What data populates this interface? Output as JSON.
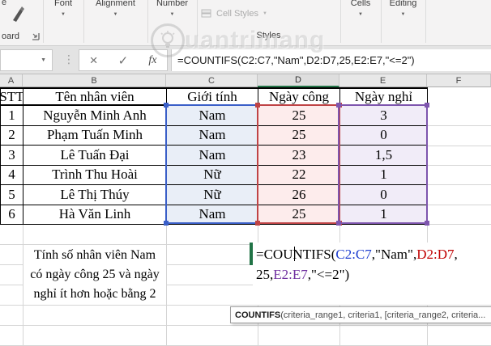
{
  "ribbon": {
    "paste_fragment": "e",
    "clipboard_label": "oard",
    "groups": [
      {
        "label": "Font"
      },
      {
        "label": "Alignment"
      },
      {
        "label": "Number"
      },
      {
        "label": "Cells"
      },
      {
        "label": "Editing"
      }
    ],
    "cell_styles_label": "Cell Styles",
    "styles_group_label": "Styles"
  },
  "watermark": {
    "text": "uantrimang"
  },
  "formula_bar": {
    "value": "=COUNTIFS(C2:C7,\"Nam\",D2:D7,25,E2:E7,\"<=2\")",
    "fx_label": "fx"
  },
  "sheet": {
    "columns": [
      "A",
      "B",
      "C",
      "D",
      "E",
      "F"
    ],
    "active_column": "D"
  },
  "table": {
    "headers": [
      "STT",
      "Tên nhân viên",
      "Giới tính",
      "Ngày công",
      "Ngày nghỉ"
    ],
    "rows": [
      [
        "1",
        "Nguyễn Minh Anh",
        "Nam",
        "25",
        "3"
      ],
      [
        "2",
        "Phạm Tuấn Minh",
        "Nam",
        "25",
        "0"
      ],
      [
        "3",
        "Lê Tuấn Đại",
        "Nam",
        "23",
        "1,5"
      ],
      [
        "4",
        "Trình Thu Hoài",
        "Nữ",
        "22",
        "1"
      ],
      [
        "5",
        "Lê Thị Thúy",
        "Nữ",
        "26",
        "0"
      ],
      [
        "6",
        "Hà Văn Linh",
        "Nam",
        "25",
        "1"
      ]
    ]
  },
  "note_cell": {
    "lines": [
      "Tính số nhân viên Nam",
      "có ngày công 25 và ngày",
      "nghỉ ít hơn hoặc bằng 2"
    ]
  },
  "formula_cell": {
    "line1_segments": [
      {
        "text": "=COUNTIFS(",
        "color": "#000000"
      },
      {
        "text": "C2:C7",
        "color": "#2040d0"
      },
      {
        "text": ",\"Nam\",",
        "color": "#000000"
      },
      {
        "text": "D2:D7",
        "color": "#c00000"
      },
      {
        "text": ",",
        "color": "#000000"
      }
    ],
    "line2_segments": [
      {
        "text": "25,",
        "color": "#000000"
      },
      {
        "text": "E2:E7",
        "color": "#7030a0"
      },
      {
        "text": ",\"<=2\")",
        "color": "#000000"
      }
    ]
  },
  "tooltip": {
    "function_name": "COUNTIFS",
    "signature": "(criteria_range1, criteria1, [criteria_range2, criteria..."
  },
  "colors": {
    "active_green": "#217346",
    "range_c_border": "#3a5fc8",
    "range_d_border": "#bf4345",
    "range_e_border": "#7e55ae",
    "range_c_fill": "#e9eef7",
    "range_d_fill": "#fdecec",
    "range_e_fill": "#f1ecf8"
  }
}
